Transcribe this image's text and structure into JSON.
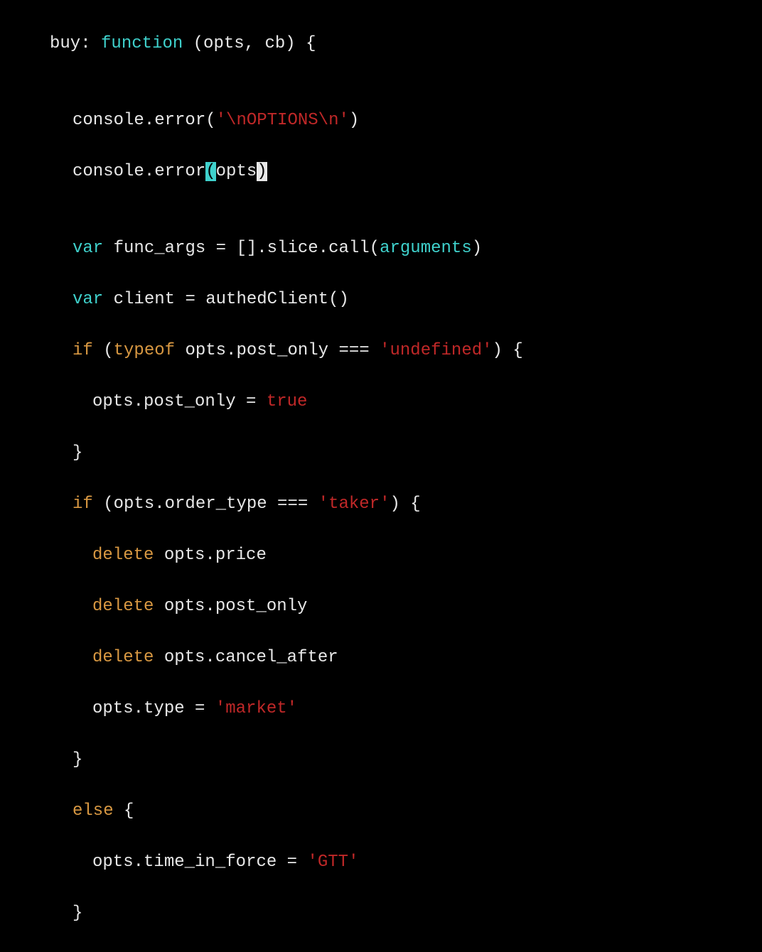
{
  "code": {
    "l1": {
      "buy": "buy",
      "colon": ": ",
      "function": "function",
      "params": " (opts, cb) {"
    },
    "l2": "",
    "l3": {
      "pre": "console.error(",
      "str": "'\\nOPTIONS\\n'",
      "post": ")"
    },
    "l4": {
      "pre": "console.error",
      "paren1": "(",
      "opts": "opts",
      "paren2": ")"
    },
    "l5": "",
    "l6": {
      "var": "var",
      "rest1": " func_args = [].slice.call(",
      "args": "arguments",
      "rest2": ")"
    },
    "l7": {
      "var": "var",
      "rest": " client = authedClient()"
    },
    "l8": {
      "if": "if",
      "p1": " (",
      "typeof": "typeof",
      "p2": " opts.post_only === ",
      "str": "'undefined'",
      "p3": ") {"
    },
    "l9": {
      "p1": "opts.post_only = ",
      "true": "true"
    },
    "l10": "}",
    "l11": {
      "if": "if",
      "p1": " (opts.order_type === ",
      "str": "'taker'",
      "p2": ") {"
    },
    "l12": {
      "delete": "delete",
      "rest": " opts.price"
    },
    "l13": {
      "delete": "delete",
      "rest": " opts.post_only"
    },
    "l14": {
      "delete": "delete",
      "rest": " opts.cancel_after"
    },
    "l15": {
      "p1": "opts.type = ",
      "str": "'market'"
    },
    "l16": "}",
    "l17": {
      "else": "else",
      "rest": " {"
    },
    "l18": {
      "p1": "opts.time_in_force = ",
      "str": "'GTT'"
    },
    "l19": "}"
  }
}
